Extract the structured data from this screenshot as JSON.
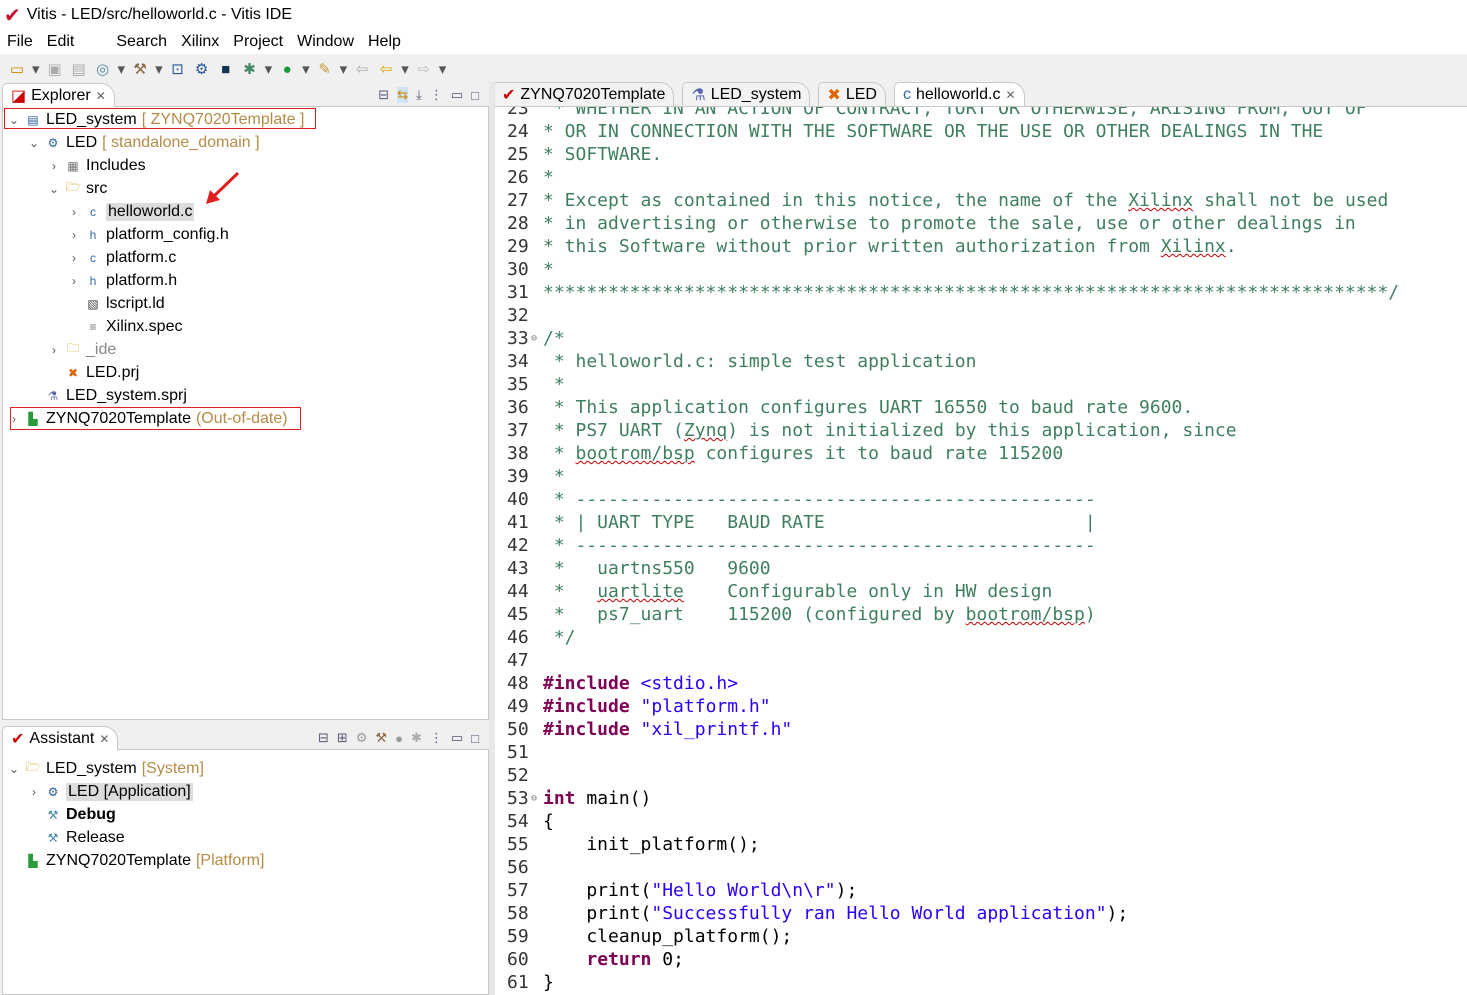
{
  "window": {
    "title": "Vitis - LED/src/helloworld.c - Vitis IDE"
  },
  "menu": [
    "File",
    "Edit",
    "Search",
    "Xilinx",
    "Project",
    "Window",
    "Help"
  ],
  "explorer": {
    "tab": "Explorer",
    "items": [
      {
        "label": "LED_system",
        "deco": "[ ZYNQ7020Template ]",
        "icon": "system-icon",
        "chev": "⌄",
        "indent": 0,
        "boxed": true
      },
      {
        "label": "LED",
        "deco": "[ standalone_domain ]",
        "icon": "application-chip-icon",
        "chev": "⌄",
        "indent": 1
      },
      {
        "label": "Includes",
        "deco": "",
        "icon": "includes-icon",
        "chev": "›",
        "indent": 2
      },
      {
        "label": "src",
        "deco": "",
        "icon": "folder-open-icon",
        "chev": "⌄",
        "indent": 2
      },
      {
        "label": "helloworld.c",
        "deco": "",
        "icon": "c-file-icon",
        "chev": "›",
        "indent": 3,
        "selected": true
      },
      {
        "label": "platform_config.h",
        "deco": "",
        "icon": "h-file-icon",
        "chev": "›",
        "indent": 3
      },
      {
        "label": "platform.c",
        "deco": "",
        "icon": "c-file-icon",
        "chev": "›",
        "indent": 3
      },
      {
        "label": "platform.h",
        "deco": "",
        "icon": "h-file-icon",
        "chev": "›",
        "indent": 3
      },
      {
        "label": "lscript.ld",
        "deco": "",
        "icon": "linker-script-icon",
        "chev": "",
        "indent": 3
      },
      {
        "label": "Xilinx.spec",
        "deco": "",
        "icon": "text-file-icon",
        "chev": "",
        "indent": 3
      },
      {
        "label": "_ide",
        "deco": "",
        "icon": "folder-icon",
        "chev": "›",
        "indent": 2,
        "muted": true
      },
      {
        "label": "LED.prj",
        "deco": "",
        "icon": "project-tools-icon",
        "chev": "",
        "indent": 2
      },
      {
        "label": "LED_system.sprj",
        "deco": "",
        "icon": "flask-icon",
        "chev": "",
        "indent": 1
      },
      {
        "label": "ZYNQ7020Template",
        "deco": "(Out-of-date)",
        "icon": "platform-icon",
        "chev": "›",
        "indent": 0,
        "boxed": true
      }
    ]
  },
  "assistant": {
    "tab": "Assistant",
    "items": [
      {
        "label": "LED_system",
        "deco": "[System]",
        "icon": "system-folder-icon",
        "chev": "⌄",
        "indent": 0
      },
      {
        "label": "LED [Application]",
        "deco": "",
        "icon": "application-chip-icon",
        "chev": "›",
        "indent": 1,
        "selected": true
      },
      {
        "label": "Debug",
        "deco": "",
        "icon": "hammer-icon",
        "chev": "",
        "indent": 1,
        "bold": true
      },
      {
        "label": "Release",
        "deco": "",
        "icon": "hammer-icon",
        "chev": "",
        "indent": 1
      },
      {
        "label": "ZYNQ7020Template",
        "deco": "[Platform]",
        "icon": "platform-icon",
        "chev": "",
        "indent": 0
      }
    ]
  },
  "editor_tabs": [
    {
      "label": "ZYNQ7020Template",
      "icon": "vitis-logo-icon"
    },
    {
      "label": "LED_system",
      "icon": "flask-icon"
    },
    {
      "label": "LED",
      "icon": "project-tools-icon"
    },
    {
      "label": "helloworld.c",
      "icon": "c-file-icon",
      "active": true
    }
  ],
  "colors": {
    "comment": "#3f7f5f",
    "keyword": "#7f0055",
    "string": "#2a00ff",
    "highlight_box": "#e02020"
  },
  "code": [
    {
      "n": "23",
      "segs": [
        [
          " * WHETHER IN AN ACTION OF CONTRACT, TORT OR OTHERWISE, ARISING FROM, OUT OF",
          "c"
        ]
      ]
    },
    {
      "n": "24",
      "segs": [
        [
          "* OR IN CONNECTION WITH THE SOFTWARE OR THE USE OR OTHER DEALINGS IN THE",
          "c"
        ]
      ]
    },
    {
      "n": "25",
      "segs": [
        [
          "* SOFTWARE.",
          "c"
        ]
      ]
    },
    {
      "n": "26",
      "segs": [
        [
          "*",
          "c"
        ]
      ]
    },
    {
      "n": "27",
      "segs": [
        [
          "* Except as contained in this notice, the name of the ",
          "c"
        ],
        [
          "Xilinx",
          "c u"
        ],
        [
          " shall not be used",
          "c"
        ]
      ]
    },
    {
      "n": "28",
      "segs": [
        [
          "* in advertising or otherwise to promote the sale, use or other dealings in",
          "c"
        ]
      ]
    },
    {
      "n": "29",
      "segs": [
        [
          "* this Software without prior written authorization from ",
          "c"
        ],
        [
          "Xilinx",
          "c u"
        ],
        [
          ".",
          "c"
        ]
      ]
    },
    {
      "n": "30",
      "segs": [
        [
          "*",
          "c"
        ]
      ]
    },
    {
      "n": "31",
      "segs": [
        [
          "******************************************************************************/",
          "c"
        ]
      ]
    },
    {
      "n": "32",
      "segs": []
    },
    {
      "n": "33",
      "fold": true,
      "segs": [
        [
          "/*",
          "c"
        ]
      ]
    },
    {
      "n": "34",
      "segs": [
        [
          " * helloworld.c: simple test application",
          "c"
        ]
      ]
    },
    {
      "n": "35",
      "segs": [
        [
          " *",
          "c"
        ]
      ]
    },
    {
      "n": "36",
      "segs": [
        [
          " * This application configures UART 16550 to baud rate 9600.",
          "c"
        ]
      ]
    },
    {
      "n": "37",
      "segs": [
        [
          " * PS7 UART (",
          "c"
        ],
        [
          "Zynq",
          "c u"
        ],
        [
          ") is not initialized by this application, since",
          "c"
        ]
      ]
    },
    {
      "n": "38",
      "segs": [
        [
          " * ",
          "c"
        ],
        [
          "bootrom/bsp",
          "c u"
        ],
        [
          " configures it to baud rate 115200",
          "c"
        ]
      ]
    },
    {
      "n": "39",
      "segs": [
        [
          " *",
          "c"
        ]
      ]
    },
    {
      "n": "40",
      "segs": [
        [
          " * ------------------------------------------------",
          "c"
        ]
      ]
    },
    {
      "n": "41",
      "segs": [
        [
          " * | UART TYPE   BAUD RATE                        |",
          "c"
        ]
      ]
    },
    {
      "n": "42",
      "segs": [
        [
          " * ------------------------------------------------",
          "c"
        ]
      ]
    },
    {
      "n": "43",
      "segs": [
        [
          " *   uartns550   9600",
          "c"
        ]
      ]
    },
    {
      "n": "44",
      "segs": [
        [
          " *   ",
          "c"
        ],
        [
          "uartlite",
          "c u"
        ],
        [
          "    Configurable only in HW design",
          "c"
        ]
      ]
    },
    {
      "n": "45",
      "segs": [
        [
          " *   ps7_uart    115200 (configured by ",
          "c"
        ],
        [
          "bootrom/bsp",
          "c u"
        ],
        [
          ")",
          "c"
        ]
      ]
    },
    {
      "n": "46",
      "segs": [
        [
          " */",
          "c"
        ]
      ]
    },
    {
      "n": "47",
      "segs": []
    },
    {
      "n": "48",
      "segs": [
        [
          "#include",
          "k"
        ],
        [
          " ",
          "p"
        ],
        [
          "<stdio.h>",
          "s"
        ]
      ]
    },
    {
      "n": "49",
      "segs": [
        [
          "#include",
          "k"
        ],
        [
          " ",
          "p"
        ],
        [
          "\"platform.h\"",
          "s"
        ]
      ]
    },
    {
      "n": "50",
      "segs": [
        [
          "#include",
          "k"
        ],
        [
          " ",
          "p"
        ],
        [
          "\"xil_printf.h\"",
          "s"
        ]
      ]
    },
    {
      "n": "51",
      "segs": []
    },
    {
      "n": "52",
      "segs": []
    },
    {
      "n": "53",
      "fold": true,
      "segs": [
        [
          "int",
          "k"
        ],
        [
          " main()",
          "p"
        ]
      ]
    },
    {
      "n": "54",
      "segs": [
        [
          "{",
          "p"
        ]
      ]
    },
    {
      "n": "55",
      "segs": [
        [
          "    init_platform();",
          "p"
        ]
      ]
    },
    {
      "n": "56",
      "segs": []
    },
    {
      "n": "57",
      "segs": [
        [
          "    print(",
          "p"
        ],
        [
          "\"Hello World\\n\\r\"",
          "s"
        ],
        [
          ");",
          "p"
        ]
      ]
    },
    {
      "n": "58",
      "segs": [
        [
          "    print(",
          "p"
        ],
        [
          "\"Successfully ran Hello World application\"",
          "s"
        ],
        [
          ");",
          "p"
        ]
      ]
    },
    {
      "n": "59",
      "segs": [
        [
          "    cleanup_platform();",
          "p"
        ]
      ]
    },
    {
      "n": "60",
      "segs": [
        [
          "    ",
          "p"
        ],
        [
          "return",
          "k"
        ],
        [
          " 0;",
          "p"
        ]
      ]
    },
    {
      "n": "61",
      "segs": [
        [
          "}",
          "p"
        ]
      ]
    }
  ]
}
